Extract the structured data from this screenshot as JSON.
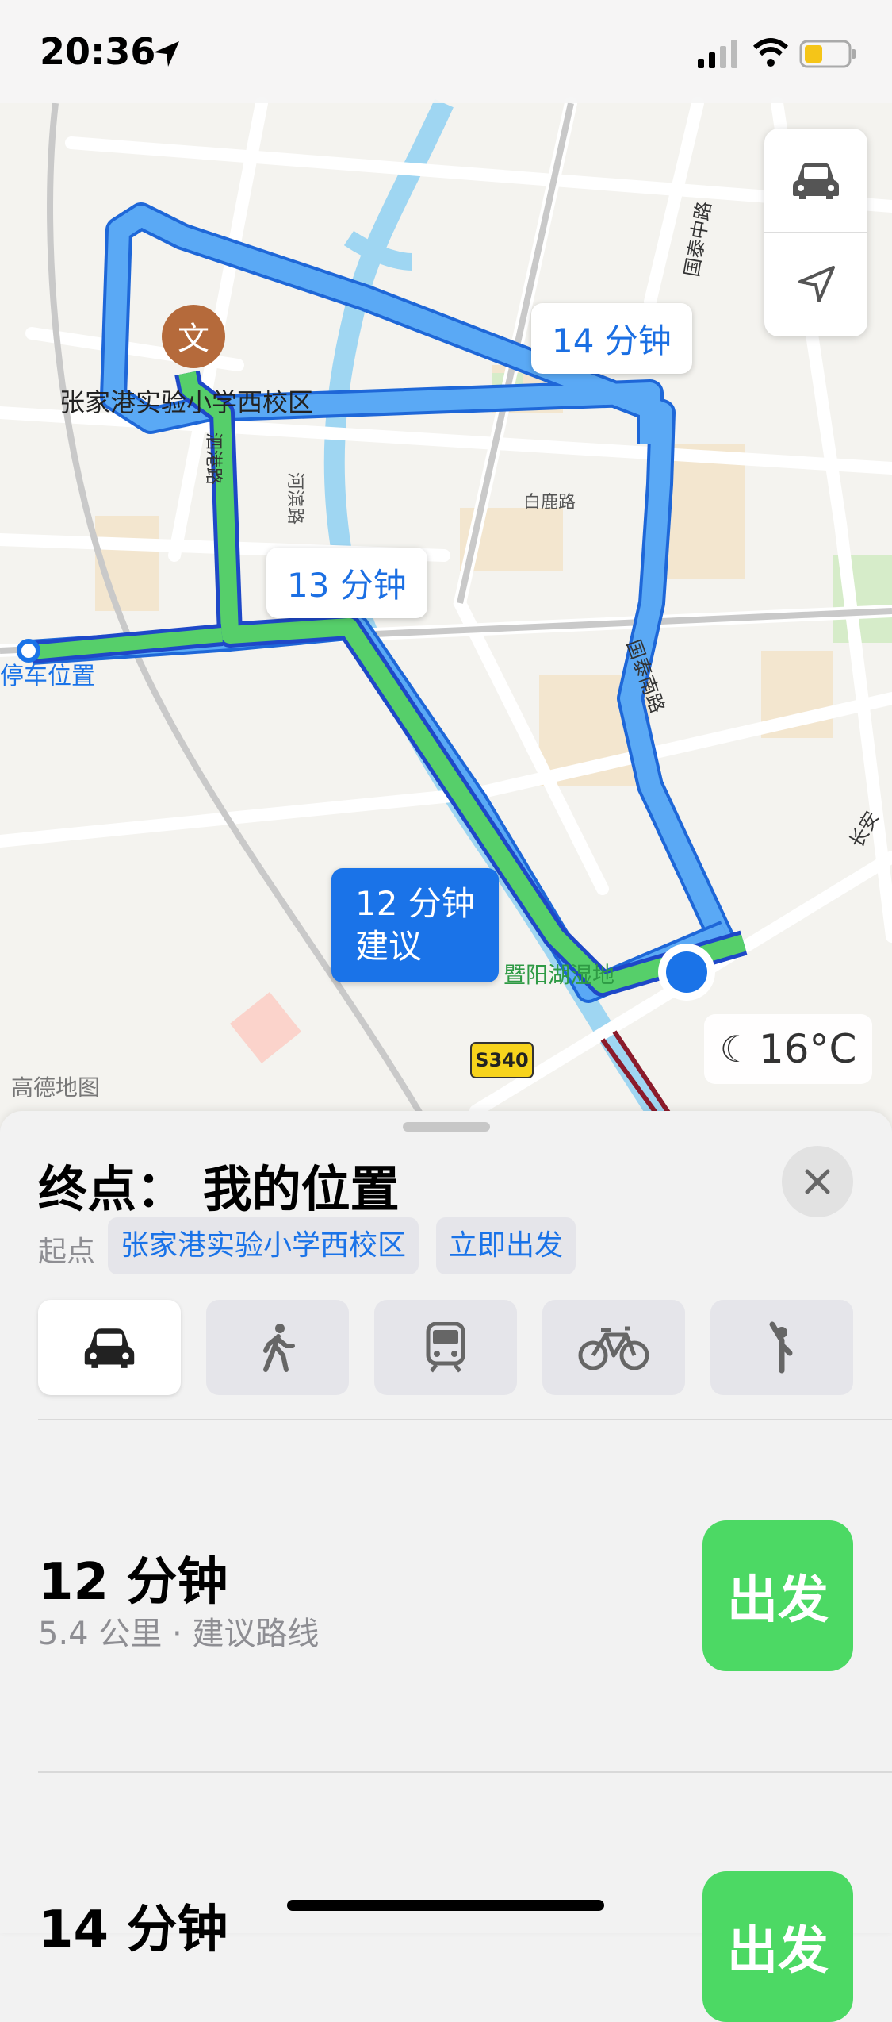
{
  "status_bar": {
    "time": "20:36"
  },
  "map": {
    "labels": {
      "poi_school": "张家港实验小学西校区",
      "parking": "停车位置",
      "road_guotai": "国泰南路",
      "road_guotai_middle": "国泰中路",
      "road_bailu": "白鹿路",
      "road_hebin": "河滨路",
      "road_sigang": "泗港路",
      "road_changan": "长安",
      "wetland": "暨阳湖湿地",
      "highway": "S340",
      "watermark": "高德地图"
    },
    "route_bubbles": {
      "r14": "14 分钟",
      "r13": "13 分钟",
      "r12_time": "12 分钟",
      "r12_tag": "建议"
    },
    "temperature": "16°C"
  },
  "sheet": {
    "title": "终点： 我的位置",
    "origin_label": "起点",
    "origin_chip": "张家港实验小学西校区",
    "depart_chip": "立即出发",
    "modes": [
      "car-icon",
      "walk-icon",
      "transit-icon",
      "bike-icon",
      "rideshare-icon"
    ],
    "routes": [
      {
        "time": "12 分钟",
        "detail": "5.4 公里 · 建议路线",
        "go": "出发"
      },
      {
        "time": "14 分钟",
        "go": "出发"
      }
    ]
  },
  "colors": {
    "route_blue": "#5aa9f5",
    "route_green": "#56cf6a",
    "accent": "#1a73e8",
    "go_green": "#4cd964"
  }
}
